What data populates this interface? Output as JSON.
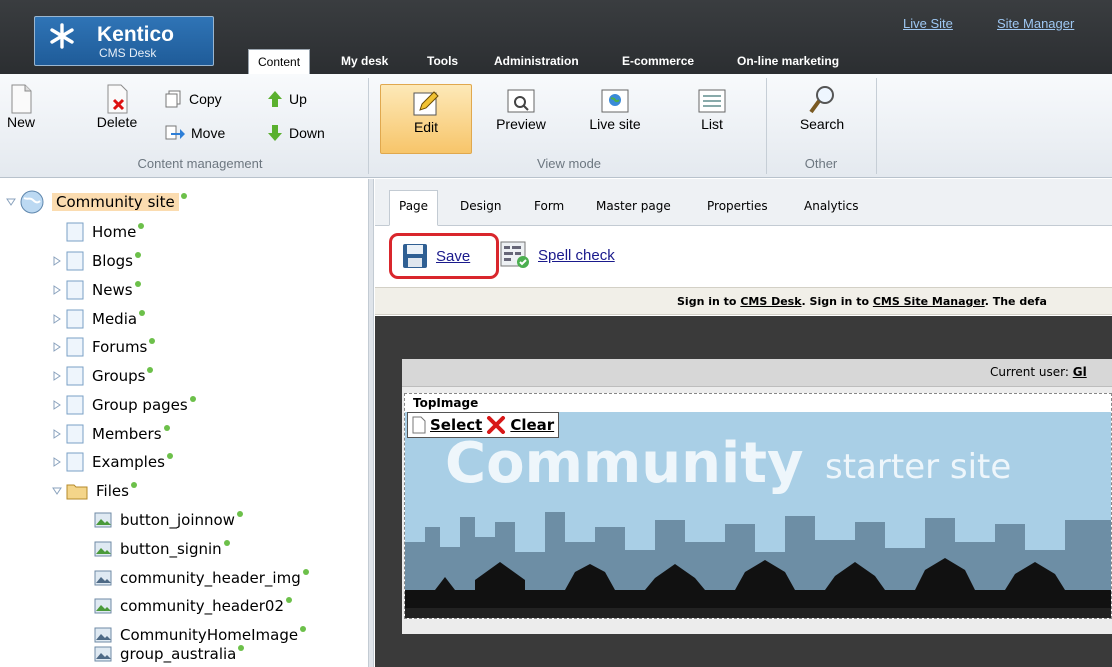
{
  "header": {
    "brand": "Kentico",
    "brand_sub": "CMS Desk",
    "links": [
      "Live Site",
      "Site Manager"
    ],
    "tabs": [
      "Content",
      "My desk",
      "Tools",
      "Administration",
      "E-commerce",
      "On-line marketing"
    ]
  },
  "ribbon": {
    "content_management": {
      "label": "Content management",
      "new": "New",
      "delete": "Delete",
      "copy": "Copy",
      "move": "Move",
      "up": "Up",
      "down": "Down"
    },
    "view_mode": {
      "label": "View mode",
      "edit": "Edit",
      "preview": "Preview",
      "live_site": "Live site",
      "list": "List"
    },
    "other": {
      "label": "Other",
      "search": "Search"
    }
  },
  "tree": {
    "root": "Community site",
    "items": [
      "Home",
      "Blogs",
      "News",
      "Media",
      "Forums",
      "Groups",
      "Group pages",
      "Members",
      "Examples"
    ],
    "files_folder": "Files",
    "files": [
      "button_joinnow",
      "button_signin",
      "community_header_img",
      "community_header02",
      "CommunityHomeImage",
      "group_australia"
    ]
  },
  "page_tabs": [
    "Page",
    "Design",
    "Form",
    "Master page",
    "Properties",
    "Analytics"
  ],
  "toolbar": {
    "save": "Save",
    "spell_check": "Spell check"
  },
  "notice": {
    "part1": "Sign in to ",
    "link1": "CMS Desk",
    "part2": ". Sign in to ",
    "link2": "CMS Site Manager",
    "part3": ". The defa"
  },
  "preview": {
    "current_user_label": "Current user:",
    "current_user_value": "Gl",
    "webpart_title": "TopImage",
    "select": "Select",
    "clear": "Clear",
    "banner_word1": "Community",
    "banner_word2": "starter site"
  },
  "colors": {
    "accent_orange": "#f7c56a",
    "highlight_red": "#d9262c",
    "status_green": "#6cc04a",
    "banner_sky": "#a9cfe6"
  }
}
